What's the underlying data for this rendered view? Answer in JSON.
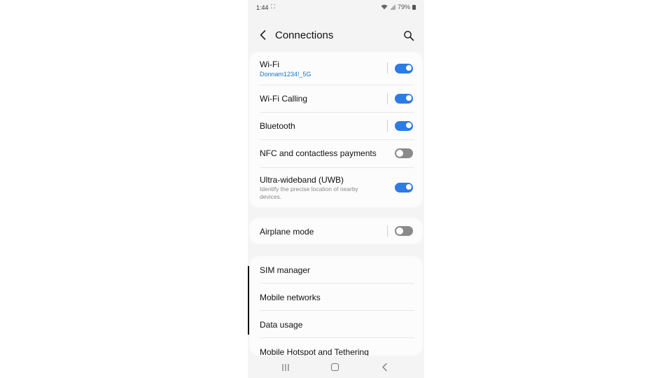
{
  "status": {
    "time": "1:44",
    "battery": "79%"
  },
  "header": {
    "title": "Connections",
    "back_icon": "back-arrow-icon",
    "search_icon": "search-icon"
  },
  "group1": {
    "items": [
      {
        "label": "Wi-Fi",
        "sub": "Donnam1234!_5G",
        "toggle": "on"
      },
      {
        "label": "Wi-Fi Calling",
        "toggle": "on"
      },
      {
        "label": "Bluetooth",
        "toggle": "on"
      },
      {
        "label": "NFC and contactless payments",
        "toggle": "off"
      },
      {
        "label": "Ultra-wideband (UWB)",
        "desc": "Identify the precise location of nearby devices.",
        "toggle": "on"
      }
    ]
  },
  "group2": {
    "items": [
      {
        "label": "Airplane mode",
        "toggle": "off"
      }
    ]
  },
  "group3": {
    "items": [
      {
        "label": "SIM manager"
      },
      {
        "label": "Mobile networks"
      },
      {
        "label": "Data usage"
      },
      {
        "label": "Mobile Hotspot and Tethering"
      }
    ]
  },
  "colors": {
    "accent": "#2d7be5",
    "subtext_link": "#1a73c8",
    "background": "#f4f4f4"
  }
}
